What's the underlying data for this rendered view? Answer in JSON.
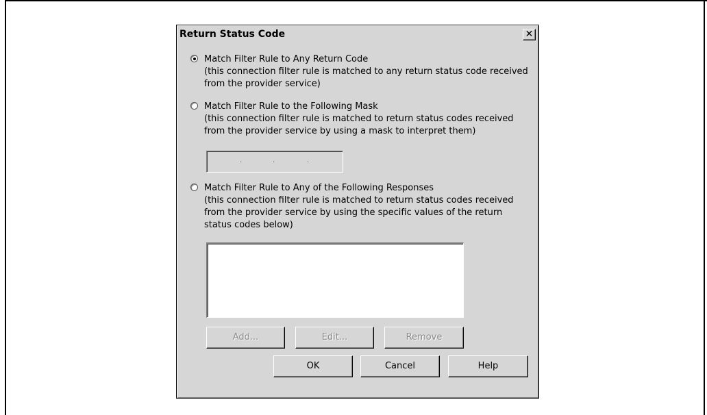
{
  "dialog": {
    "title": "Return Status Code",
    "close_glyph": "✕"
  },
  "options": [
    {
      "checked": true,
      "label": "Match Filter Rule to Any Return Code",
      "desc_lines": [
        "(this connection filter rule is matched to any return status code received",
        "from the provider service)"
      ]
    },
    {
      "checked": false,
      "label": "Match Filter Rule to the Following Mask",
      "desc_lines": [
        "(this connection filter rule is matched to return status codes received",
        "from the provider service by using a mask to interpret them)"
      ]
    },
    {
      "checked": false,
      "label": "Match Filter Rule to Any of the Following Responses",
      "desc_lines": [
        "(this connection filter rule is matched to return status codes received",
        "from the provider service by using the specific values of the return",
        "status codes below)"
      ]
    }
  ],
  "mask": {
    "separator": "."
  },
  "list_buttons": {
    "add": "Add...",
    "edit": "Edit...",
    "remove": "Remove"
  },
  "footer_buttons": {
    "ok": "OK",
    "cancel": "Cancel",
    "help": "Help"
  }
}
